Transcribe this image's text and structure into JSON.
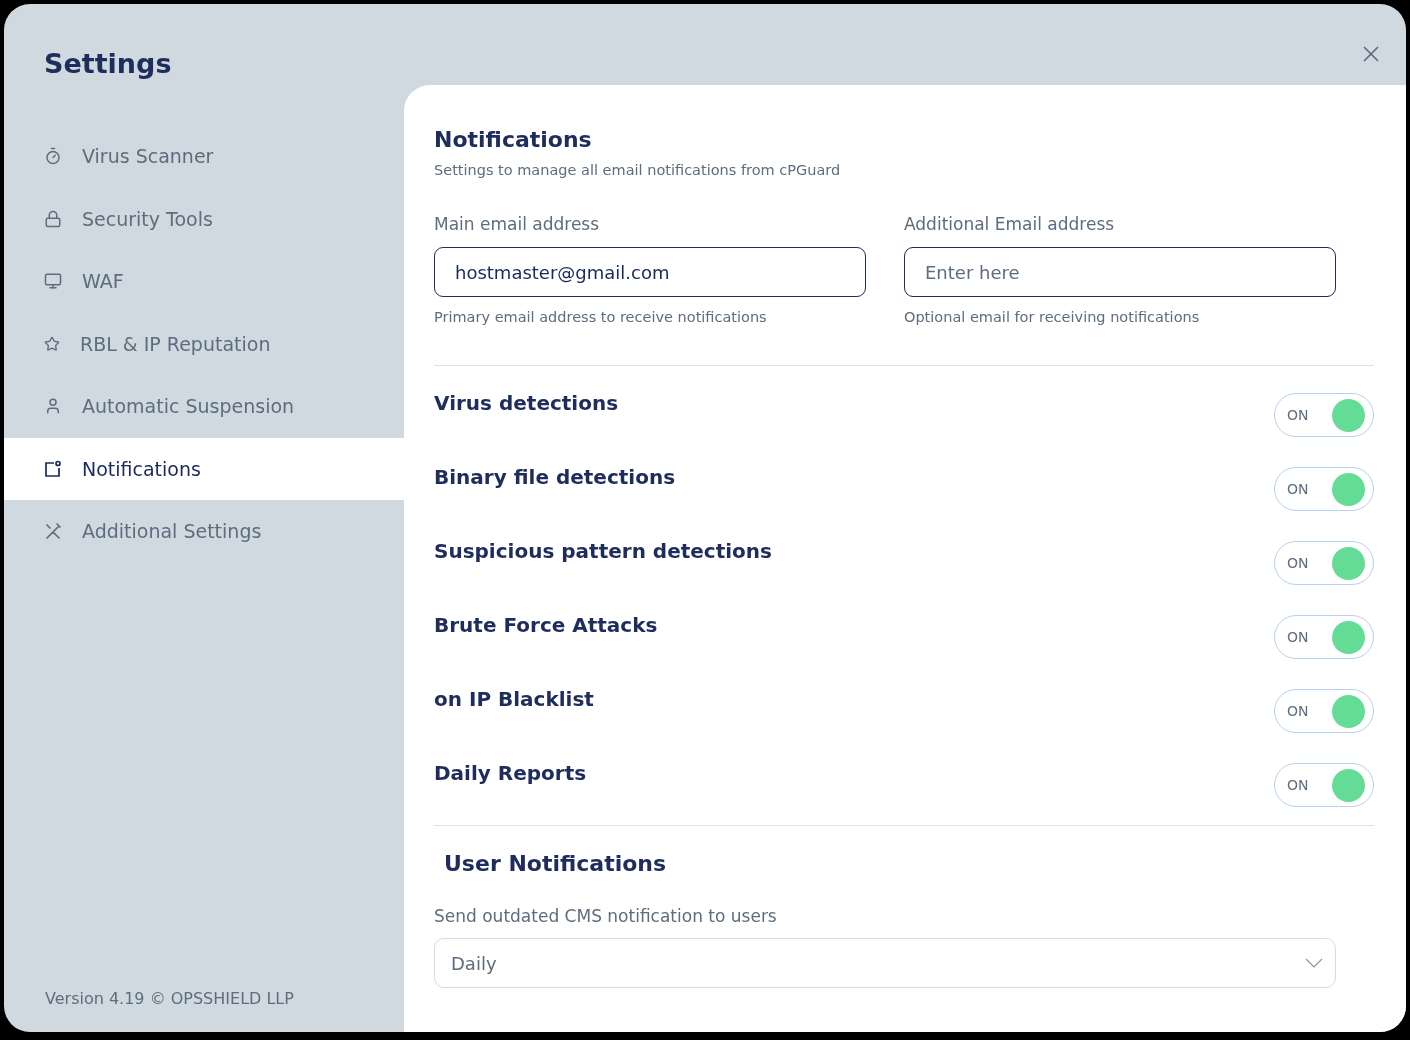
{
  "window": {
    "title": "Settings"
  },
  "sidebar": {
    "items": [
      {
        "label": "Virus Scanner",
        "selected": false
      },
      {
        "label": "Security Tools",
        "selected": false
      },
      {
        "label": "WAF",
        "selected": false
      },
      {
        "label": "RBL & IP Reputation",
        "selected": false
      },
      {
        "label": "Automatic Suspension",
        "selected": false
      },
      {
        "label": "Notifications",
        "selected": true
      },
      {
        "label": "Additional Settings",
        "selected": false
      }
    ],
    "footer": "Version 4.19 © OPSSHIELD LLP"
  },
  "section": {
    "title": "Notifications",
    "subtitle": "Settings to manage all email notifications from cPGuard",
    "fields": [
      {
        "label": "Main email address",
        "value": "hostmaster@gmail.com",
        "hint": "Primary email address to receive notifications"
      },
      {
        "label": "Additional Email address",
        "placeholder": "Enter here",
        "hint": "Optional email for receiving notifications"
      }
    ],
    "toggles": [
      {
        "label": "Virus detections",
        "state": "ON",
        "on": true
      },
      {
        "label": "Binary file detections",
        "state": "ON",
        "on": true
      },
      {
        "label": "Suspicious pattern detections",
        "state": "ON",
        "on": true
      },
      {
        "label": "Brute Force Attacks",
        "state": "ON",
        "on": true
      },
      {
        "label": "on IP Blacklist",
        "state": "ON",
        "on": true
      },
      {
        "label": "Daily Reports",
        "state": "ON",
        "on": true
      }
    ]
  },
  "user_notifications": {
    "title": "User Notifications",
    "label": "Send outdated CMS notification to users",
    "value": "Daily"
  }
}
